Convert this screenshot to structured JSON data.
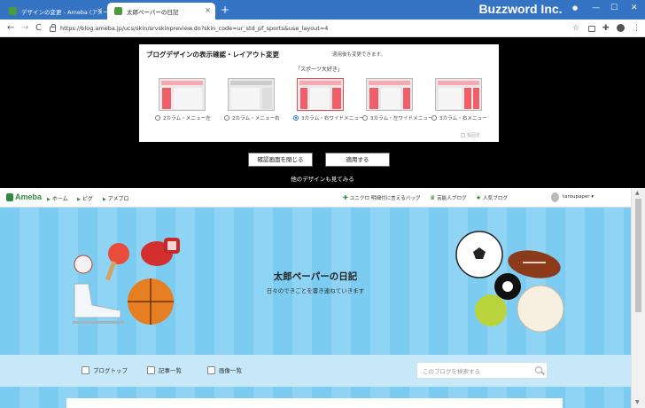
{
  "browser": {
    "tabs": [
      {
        "title": "デザインの変更 - Ameba (アメーバ)",
        "close": "×",
        "favicon_color": "#2d8c3c"
      },
      {
        "title": "太郎ペーパーの日記",
        "close": "×",
        "favicon_color": "#2d8c3c"
      }
    ],
    "new_tab": "+",
    "brand": "Buzzword Inc.",
    "window_controls": {
      "minimize": "—",
      "maximize": "☐",
      "close": "✕"
    },
    "url": "https://blog.ameba.jp/ucs/skin/srvskinpreview.do?skin_code=ur_std_pf_sports&use_layout=4",
    "nav": {
      "back": "←",
      "forward": "→",
      "reload": "C"
    },
    "toolbar_icons": {
      "star": "☆",
      "extensions": "✚",
      "menu": "⋮"
    }
  },
  "dialog": {
    "title": "ブログデザインの表示確認・レイアウト変更",
    "note": "適用後も変更できます。",
    "theme": "「スポーツ大好き」",
    "layouts": [
      {
        "label": "2カラム・メニュー左",
        "selected": false
      },
      {
        "label": "2カラム・メニュー右",
        "selected": false
      },
      {
        "label": "3カラム・右ワイドメニュー",
        "selected": true
      },
      {
        "label": "3カラム・左ワイドメニュー",
        "selected": false
      },
      {
        "label": "3カラム・右メニュー",
        "selected": false
      }
    ],
    "fixed_width": "幅固定",
    "close_button": "確認画面を閉じる",
    "apply_button": "適用する",
    "other_link": "他のデザインも見てみる"
  },
  "ameba": {
    "logo": "Ameba",
    "nav": [
      "ホーム",
      "ピグ",
      "アメブロ"
    ],
    "right_links": [
      "ユニクロ 明細付に言えるバッグ",
      "芸能人ブログ",
      "人気ブログ"
    ],
    "username": "taroupaper"
  },
  "blog": {
    "title": "太郎ペーパーの日記",
    "description": "日々のできごとを書き連ねていきます",
    "menu": [
      "ブログトップ",
      "記事一覧",
      "画像一覧"
    ],
    "search_placeholder": "このブログを検索する"
  }
}
